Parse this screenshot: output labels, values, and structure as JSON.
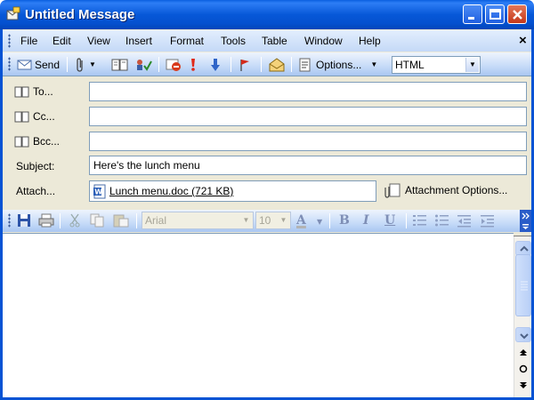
{
  "window": {
    "title": "Untitled Message"
  },
  "menu": {
    "items": [
      "File",
      "Edit",
      "View",
      "Insert",
      "Format",
      "Tools",
      "Table",
      "Window",
      "Help"
    ],
    "close_label": "×"
  },
  "toolbar": {
    "send_label": "Send",
    "options_label": "Options...",
    "format_value": "HTML"
  },
  "header": {
    "to_label": "To...",
    "cc_label": "Cc...",
    "bcc_label": "Bcc...",
    "subject_label": "Subject:",
    "attach_label": "Attach...",
    "to_value": "",
    "cc_value": "",
    "bcc_value": "",
    "subject_value": "Here's the lunch menu",
    "attachment_name": "Lunch menu.doc (721 KB)",
    "attachment_options_label": "Attachment Options..."
  },
  "formatting": {
    "font_name": "Arial",
    "font_size": "10",
    "bold": "B",
    "italic": "I",
    "underline": "U",
    "font_color_glyph": "A"
  },
  "colors": {
    "titlebar": "#0553d4",
    "chrome": "#ece9d8",
    "toolbar": "#c6dbf8"
  },
  "body": {
    "text": ""
  }
}
